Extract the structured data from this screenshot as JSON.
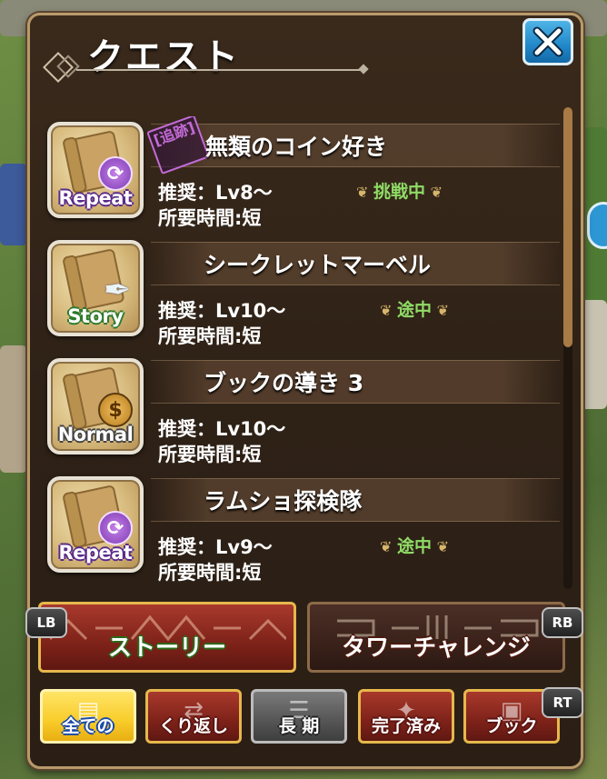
{
  "window": {
    "title": "クエスト"
  },
  "close_button": {
    "label": "✕"
  },
  "quests": [
    {
      "tag": "[追跡]",
      "name": "無類のコイン好き",
      "type_label": "Repeat",
      "recommend": "推奨：Lv8～",
      "time": "所要時間:短",
      "status": "挑戦中"
    },
    {
      "tag": "",
      "name": "シークレットマーベル",
      "type_label": "Story",
      "recommend": "推奨：Lv10～",
      "time": "所要時間:短",
      "status": "途中"
    },
    {
      "tag": "",
      "name": "ブックの導き 3",
      "type_label": "Normal",
      "recommend": "推奨：Lv10～",
      "time": "所要時間:短",
      "status": ""
    },
    {
      "tag": "",
      "name": "ラムショ探検隊",
      "type_label": "Repeat",
      "recommend": "推奨：Lv9～",
      "time": "所要時間:短",
      "status": "途中"
    }
  ],
  "categories": {
    "lb": "LB",
    "rb": "RB",
    "story": "ストーリー",
    "tower": "タワーチャレンジ"
  },
  "filters": {
    "rt": "RT",
    "items": [
      "全ての",
      "くり返し",
      "長 期",
      "完了済み",
      "ブック"
    ],
    "selected": "全ての"
  },
  "colors": {
    "status_green": "#8fdb66",
    "tracking_purple": "#c26bd6",
    "close_blue": "#2187c8",
    "button_gold_border": "#e6b84c"
  }
}
